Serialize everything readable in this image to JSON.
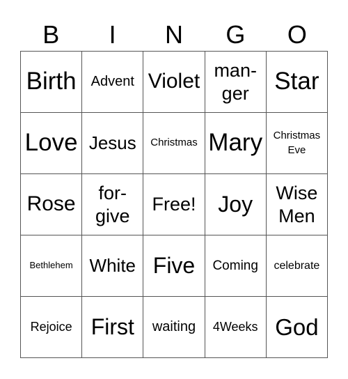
{
  "header": {
    "letters": [
      "B",
      "I",
      "N",
      "G",
      "O"
    ]
  },
  "grid": {
    "rows": [
      [
        "Birth",
        "Advent",
        "Violet",
        "man-\nger",
        "Star"
      ],
      [
        "Love",
        "Jesus",
        "Christmas",
        "Mary",
        "Christmas\nEve"
      ],
      [
        "Rose",
        "for-\ngive",
        "Free!",
        "Joy",
        "Wise\nMen"
      ],
      [
        "Bethlehem",
        "White",
        "Five",
        "Coming",
        "celebrate"
      ],
      [
        "Rejoice",
        "First",
        "waiting",
        "4Weeks",
        "God"
      ]
    ]
  }
}
